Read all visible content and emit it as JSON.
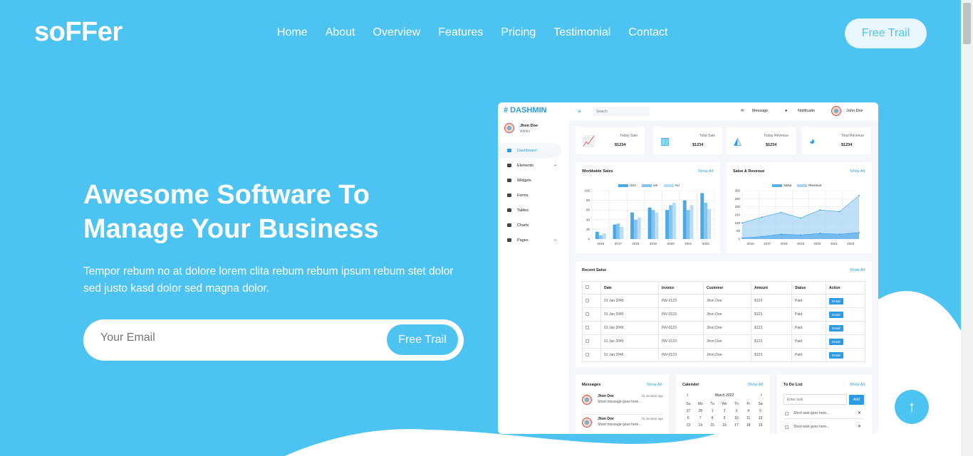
{
  "brand": "soFFer",
  "nav": [
    "Home",
    "About",
    "Overview",
    "Features",
    "Pricing",
    "Testimonial",
    "Contact"
  ],
  "nav_button": "Free Trail",
  "hero": {
    "title_line1": "Awesome Software To",
    "title_line2": "Manage Your Business",
    "text": "Tempor rebum no at dolore lorem clita rebum rebum ipsum rebum stet dolor sed justo kasd dolor sed magna dolor.",
    "email_placeholder": "Your Email",
    "button": "Free Trail"
  },
  "colors": {
    "primary": "#4dc3f2",
    "dashboard_accent": "#2c9be4"
  },
  "scroll_up_icon": "arrow-up-icon",
  "dashboard": {
    "brand": "# DASHMIN",
    "user_name": "Jhon Doe",
    "user_role": "Admin",
    "menu": [
      "Dashboard",
      "Elements",
      "Widgets",
      "Forms",
      "Tables",
      "Charts",
      "Pages"
    ],
    "search_placeholder": "Search",
    "top_message": "Message",
    "top_notification": "Notificatin",
    "top_user": "John Doe",
    "stats": [
      {
        "label": "Today Sale",
        "value": "$1234"
      },
      {
        "label": "Total Sale",
        "value": "$1234"
      },
      {
        "label": "Today Revenue",
        "value": "$1234"
      },
      {
        "label": "Total Revenue",
        "value": "$1234"
      }
    ],
    "show_all": "Show All",
    "worldwide_title": "Worldwide Sales",
    "sales_revenue_title": "Salse & Revenue",
    "recent_title": "Recent Salse",
    "table_headers": [
      "Date",
      "Invoice",
      "Customer",
      "Amount",
      "Status",
      "Action"
    ],
    "table_rows": [
      [
        "01 Jan 2045",
        "INV-0123",
        "Jhon Doe",
        "$123",
        "Paid",
        "Detail"
      ],
      [
        "01 Jan 2045",
        "INV-0123",
        "Jhon Doe",
        "$123",
        "Paid",
        "Detail"
      ],
      [
        "01 Jan 2045",
        "INV-0123",
        "Jhon Doe",
        "$123",
        "Paid",
        "Detail"
      ],
      [
        "01 Jan 2045",
        "INV-0123",
        "Jhon Doe",
        "$123",
        "Paid",
        "Detail"
      ],
      [
        "01 Jan 2045",
        "INV-0123",
        "Jhon Doe",
        "$123",
        "Paid",
        "Detail"
      ]
    ],
    "messages_title": "Messages",
    "messages": [
      {
        "name": "Jhon Doe",
        "time": "15 minutes ago",
        "text": "Short message goes here..."
      },
      {
        "name": "Jhon Doe",
        "time": "15 minutes ago",
        "text": "Short message goes here..."
      }
    ],
    "calendar_title": "Calender",
    "calendar_month": "March 2022",
    "calendar_days": [
      "Su",
      "Mo",
      "Tu",
      "We",
      "Th",
      "Fr",
      "Sa"
    ],
    "calendar_dates": [
      "27",
      "28",
      "1",
      "2",
      "3",
      "4",
      "5",
      "6",
      "7",
      "8",
      "9",
      "10",
      "11",
      "12",
      "13",
      "14",
      "15",
      "16",
      "17",
      "18",
      "19"
    ],
    "todo_title": "To Do List",
    "todo_placeholder": "Enter task",
    "todo_add": "Add",
    "todo_items": [
      "Short task goes here...",
      "Short task goes here..."
    ]
  },
  "chart_data": [
    {
      "type": "bar",
      "title": "Worldwide Sales",
      "categories": [
        "2016",
        "2017",
        "2018",
        "2019",
        "2020",
        "2021",
        "2022"
      ],
      "ylim": [
        0,
        100
      ],
      "yticks": [
        "100",
        "80",
        "60",
        "40",
        "20",
        "0"
      ],
      "series": [
        {
          "name": "USA",
          "color": "#48a9e6",
          "values": [
            15,
            30,
            55,
            65,
            60,
            80,
            95
          ]
        },
        {
          "name": "UK",
          "color": "#85c3ef",
          "values": [
            8,
            32,
            40,
            60,
            70,
            60,
            75
          ]
        },
        {
          "name": "AU",
          "color": "#b9ddf6",
          "values": [
            12,
            25,
            45,
            55,
            75,
            70,
            62
          ]
        }
      ]
    },
    {
      "type": "area",
      "title": "Salse & Revenue",
      "categories": [
        "2016",
        "2017",
        "2018",
        "2019",
        "2020",
        "2021",
        "2022"
      ],
      "ylim": [
        0,
        300
      ],
      "yticks": [
        "300",
        "250",
        "200",
        "150",
        "100",
        "50",
        "0"
      ],
      "series": [
        {
          "name": "Salse",
          "color": "#5baeea",
          "values": [
            7,
            15,
            30,
            25,
            35,
            30,
            40
          ]
        },
        {
          "name": "Revenue",
          "color": "#a8d4f3",
          "values": [
            100,
            135,
            165,
            130,
            180,
            170,
            270
          ]
        }
      ]
    }
  ]
}
